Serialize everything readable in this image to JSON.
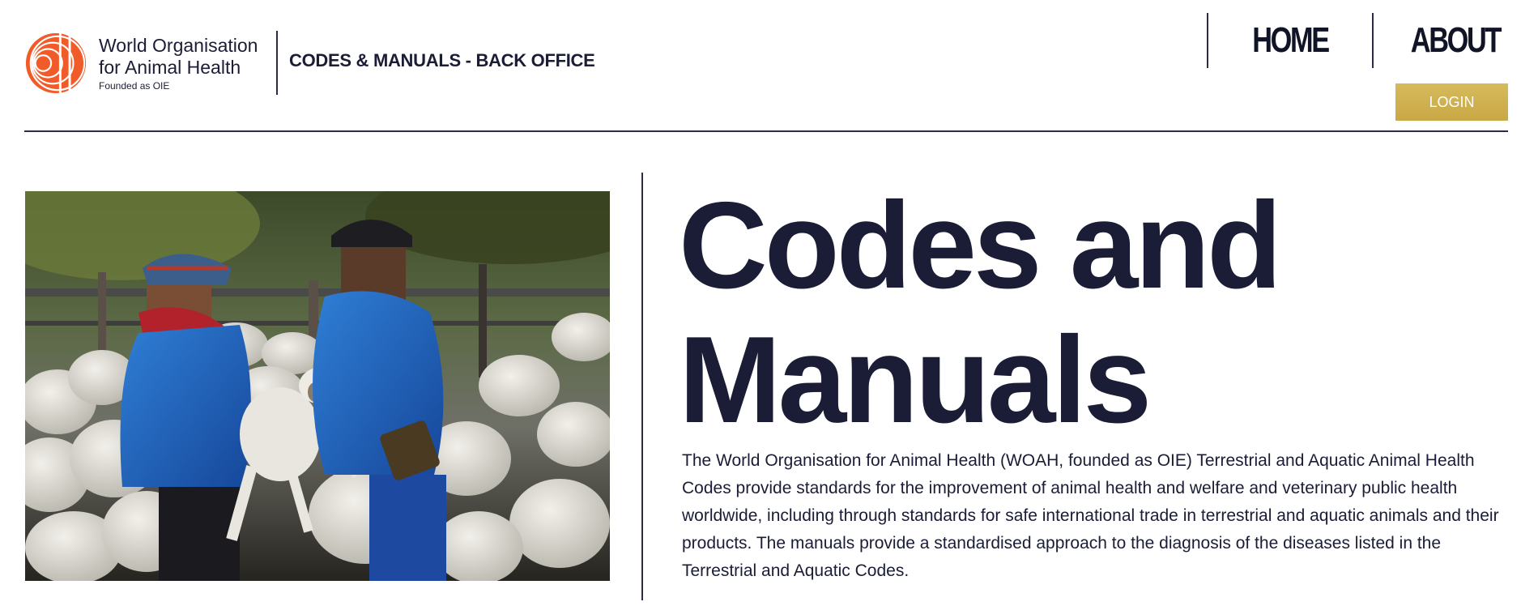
{
  "header": {
    "logo": {
      "line1": "World Organisation",
      "line2": "for Animal Health",
      "founded": "Founded as OIE",
      "mark_color": "#f15a29"
    },
    "site_title": "CODES & MANUALS - BACK OFFICE",
    "nav": [
      {
        "label": "HOME"
      },
      {
        "label": "ABOUT"
      }
    ],
    "login_label": "LOGIN",
    "login_color": "#d1b352"
  },
  "hero": {
    "image_alt": "Two farmers in blue work jackets holding a lamb among a flock of sheep",
    "title_line1": "Codes and",
    "title_line2": "Manuals",
    "description": "The World Organisation for Animal Health (WOAH, founded as OIE) Terrestrial and Aquatic Animal Health Codes provide standards for the improvement of animal health and welfare and veterinary public health worldwide, including through standards for safe international trade in terrestrial and aquatic animals and their products. The manuals provide a standardised approach to the diagnosis of the diseases listed in the Terrestrial and Aquatic Codes."
  },
  "colors": {
    "text": "#1a1d35",
    "accent_gold": "#d1b352",
    "logo_orange": "#f15a29"
  }
}
